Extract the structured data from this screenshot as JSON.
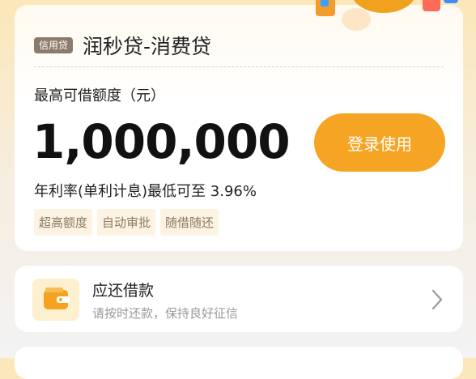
{
  "product": {
    "tag": "信用贷",
    "name": "润秒贷-消费贷",
    "limit_label": "最高可借额度（元）",
    "limit_value": "1,000,000",
    "rate_text": "年利率(单利计息)最低可至 3.96%",
    "login_button": "登录使用",
    "features": [
      "超高额度",
      "自动审批",
      "随借随还"
    ]
  },
  "repay": {
    "title": "应还借款",
    "subtitle": "请按时还款，保持良好征信",
    "icon": "wallet-icon"
  },
  "colors": {
    "accent": "#f5a523",
    "tag_bg": "#8c7b6a",
    "feature_bg": "#fdf3e2"
  }
}
